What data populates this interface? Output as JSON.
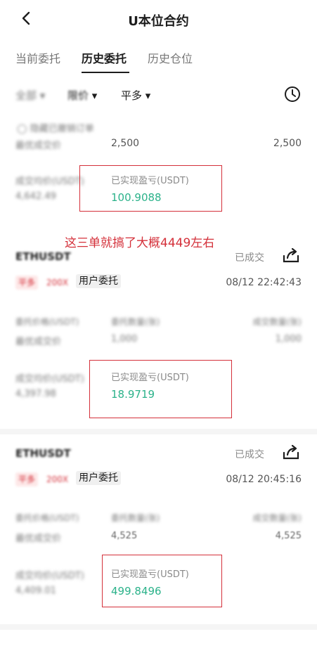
{
  "header": {
    "back_icon": "chevron-left-icon",
    "title": "U本位合约"
  },
  "tabs": [
    "当前委托",
    "历史委托",
    "历史仓位"
  ],
  "filters": {
    "all": "全部",
    "price": "限价",
    "side": "平多"
  },
  "hide_cancel": "隐藏已撤销订单",
  "annotation": "这三单就搞了大概4449左右",
  "top_partial": {
    "left_label": "最优成交价",
    "left_value": "2,500",
    "right_value": "2,500",
    "avg_label": "成交均价(USDT)",
    "avg_value": "4,642.49",
    "pnl_label": "已实现盈亏(USDT)",
    "pnl_value": "100.9088"
  },
  "orders": [
    {
      "symbol": "ETHUSDT",
      "status": "已成交",
      "side": "平多",
      "leverage": "200X",
      "order_type": "用户委托",
      "time": "08/12 22:42:43",
      "col1_label": "委托价格(USDT)",
      "col2_label": "委托数量(张)",
      "col3_label": "成交数量(张)",
      "row2_label": "最优成交价",
      "qty": "1,000",
      "filled": "1,000",
      "avg_label": "成交均价(USDT)",
      "avg_value": "4,397.98",
      "pnl_label": "已实现盈亏(USDT)",
      "pnl_value": "18.9719"
    },
    {
      "symbol": "ETHUSDT",
      "status": "已成交",
      "side": "平多",
      "leverage": "200X",
      "order_type": "用户委托",
      "time": "08/12 20:45:16",
      "col1_label": "委托价格(USDT)",
      "col2_label": "委托数量(张)",
      "col3_label": "成交数量(张)",
      "row2_label": "最优成交价",
      "qty": "4,525",
      "filled": "4,525",
      "avg_label": "成交均价(USDT)",
      "avg_value": "4,409.01",
      "pnl_label": "已实现盈亏(USDT)",
      "pnl_value": "499.8496"
    }
  ],
  "colors": {
    "accent_red": "#d4303a",
    "profit_green": "#2bb28a"
  }
}
